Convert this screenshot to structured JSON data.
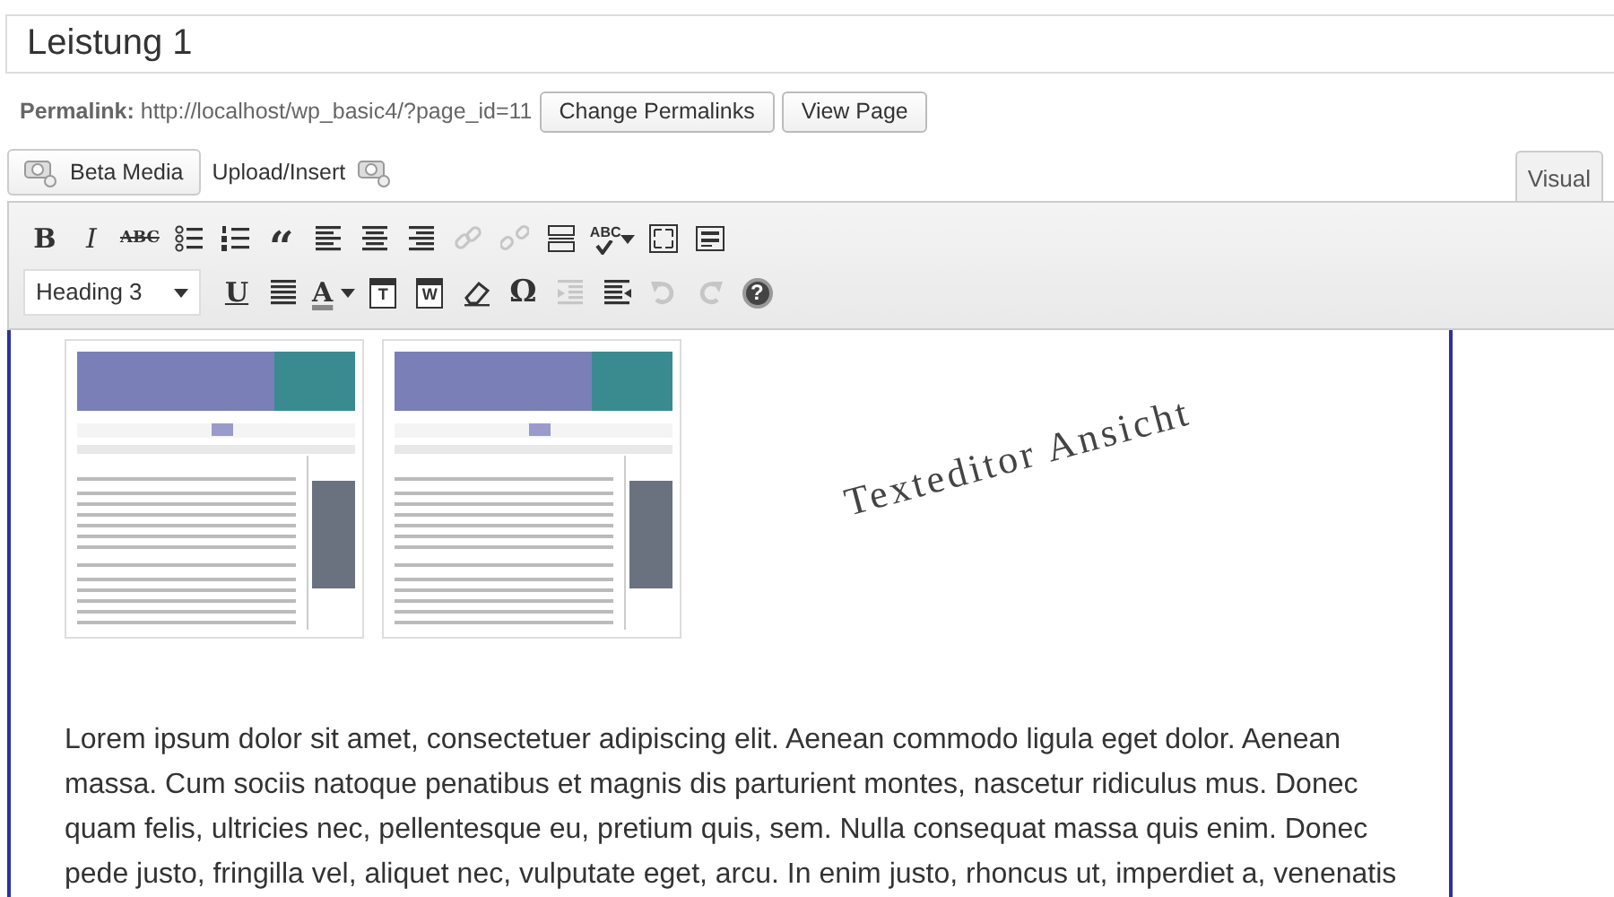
{
  "title": {
    "value": "Leistung 1"
  },
  "permalink": {
    "label": "Permalink:",
    "url": "http://localhost/wp_basic4/?page_id=11",
    "buttons": [
      "Change Permalinks",
      "View Page"
    ]
  },
  "media": {
    "button": "Beta Media",
    "link": "Upload/Insert"
  },
  "editor_tabs": [
    {
      "label": "Visual",
      "selected": true
    }
  ],
  "toolbar_row_1": [
    {
      "kind": "bold",
      "glyph": "B",
      "disabled": false
    },
    {
      "kind": "italic",
      "glyph": "I",
      "disabled": false
    },
    {
      "kind": "strike",
      "glyph": "ABC",
      "disabled": false
    },
    {
      "kind": "bullets",
      "disabled": false
    },
    {
      "kind": "numbers",
      "disabled": false
    },
    {
      "kind": "quote",
      "glyph": "“",
      "disabled": false
    },
    {
      "kind": "align-left",
      "disabled": false
    },
    {
      "kind": "align-center",
      "disabled": false
    },
    {
      "kind": "align-right",
      "disabled": false
    },
    {
      "kind": "link",
      "disabled": true
    },
    {
      "kind": "unlink",
      "disabled": true
    },
    {
      "kind": "more",
      "disabled": false
    },
    {
      "kind": "spell",
      "glyph": "ABC",
      "disabled": false,
      "dropdown": true
    },
    {
      "kind": "fullscreen",
      "disabled": false
    },
    {
      "kind": "kitchen",
      "disabled": false
    }
  ],
  "format_select": {
    "value": "Heading 3"
  },
  "toolbar_row_2": [
    {
      "kind": "underline",
      "glyph": "U",
      "disabled": false
    },
    {
      "kind": "justify",
      "disabled": false
    },
    {
      "kind": "color",
      "glyph": "A",
      "disabled": false,
      "dropdown": true
    },
    {
      "kind": "paste",
      "glyph": "T",
      "disabled": false
    },
    {
      "kind": "paste",
      "glyph": "W",
      "disabled": false
    },
    {
      "kind": "eraser",
      "disabled": false
    },
    {
      "kind": "symbol",
      "glyph": "Ω",
      "disabled": false
    },
    {
      "kind": "outdent",
      "disabled": true
    },
    {
      "kind": "indent",
      "disabled": false
    },
    {
      "kind": "undo",
      "disabled": true
    },
    {
      "kind": "redo",
      "disabled": true
    },
    {
      "kind": "help",
      "glyph": "?",
      "disabled": false
    }
  ],
  "content": {
    "paragraph_lines": [
      "Lorem ipsum dolor sit amet, consectetuer adipiscing elit. Aenean commodo ligula eget dolor. Aenean",
      "massa. Cum sociis natoque penatibus et magnis dis parturient montes, nascetur ridiculus mus. Donec",
      "quam felis, ultricies nec, pellentesque eu, pretium quis, sem. Nulla consequat massa quis enim. Donec",
      "pede justo, fringilla vel, aliquet nec, vulputate eget, arcu. In enim justo, rhoncus ut, imperdiet a, venenatis"
    ]
  },
  "annotation": "Texteditor Ansicht"
}
